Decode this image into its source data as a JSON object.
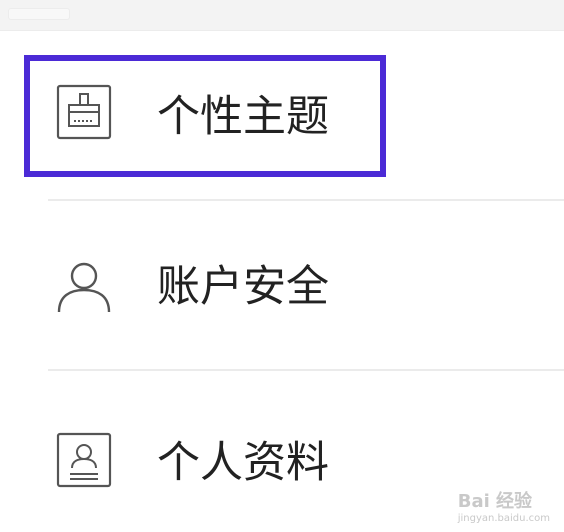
{
  "menu": {
    "items": [
      {
        "label": "个性主题",
        "icon": "brush-icon",
        "highlighted": true
      },
      {
        "label": "账户安全",
        "icon": "user-icon",
        "highlighted": false
      },
      {
        "label": "个人资料",
        "icon": "id-card-icon",
        "highlighted": false
      }
    ]
  },
  "colors": {
    "highlight_border": "#4b2ad6",
    "text": "#222222",
    "icon": "#555555",
    "divider": "#ebebeb"
  },
  "watermark": {
    "brand": "Bai 经验",
    "url": "jingyan.baidu.com"
  }
}
